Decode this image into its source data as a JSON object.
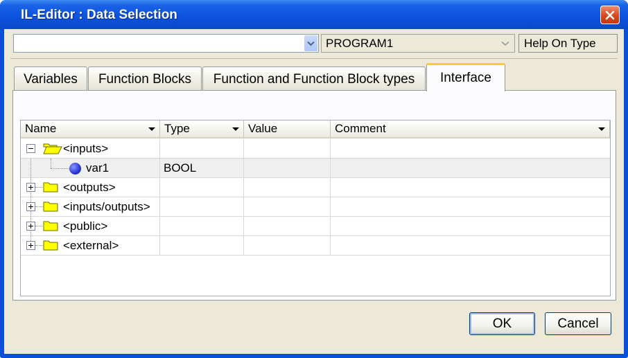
{
  "window": {
    "title": "IL-Editor : Data Selection"
  },
  "toolbar": {
    "left_combo_value": "",
    "program_combo_value": "PROGRAM1",
    "help_button_label": "Help On Type"
  },
  "tabs": [
    {
      "label": "Variables",
      "active": false
    },
    {
      "label": "Function Blocks",
      "active": false
    },
    {
      "label": "Function and Function Block types",
      "active": false
    },
    {
      "label": "Interface",
      "active": true
    }
  ],
  "grid": {
    "columns": [
      "Name",
      "Type",
      "Value",
      "Comment"
    ],
    "rows": [
      {
        "name": "<inputs>",
        "type": "",
        "value": "",
        "comment": "",
        "kind": "folder-open",
        "expanded": true
      },
      {
        "name": "var1",
        "type": "BOOL",
        "value": "",
        "comment": "",
        "kind": "variable"
      },
      {
        "name": "<outputs>",
        "type": "",
        "value": "",
        "comment": "",
        "kind": "folder",
        "expanded": false
      },
      {
        "name": "<inputs/outputs>",
        "type": "",
        "value": "",
        "comment": "",
        "kind": "folder",
        "expanded": false
      },
      {
        "name": "<public>",
        "type": "",
        "value": "",
        "comment": "",
        "kind": "folder",
        "expanded": false
      },
      {
        "name": "<external>",
        "type": "",
        "value": "",
        "comment": "",
        "kind": "folder",
        "expanded": false
      }
    ]
  },
  "buttons": {
    "ok_label": "OK",
    "cancel_label": "Cancel"
  },
  "colors": {
    "titlebar": "#0b52dc",
    "dialog_face": "#ece9d8",
    "active_tab_accent": "#ffc83c",
    "close_button": "#d9461b",
    "folder_yellow": "#ffff00",
    "variable_bullet": "#2a35d6"
  }
}
